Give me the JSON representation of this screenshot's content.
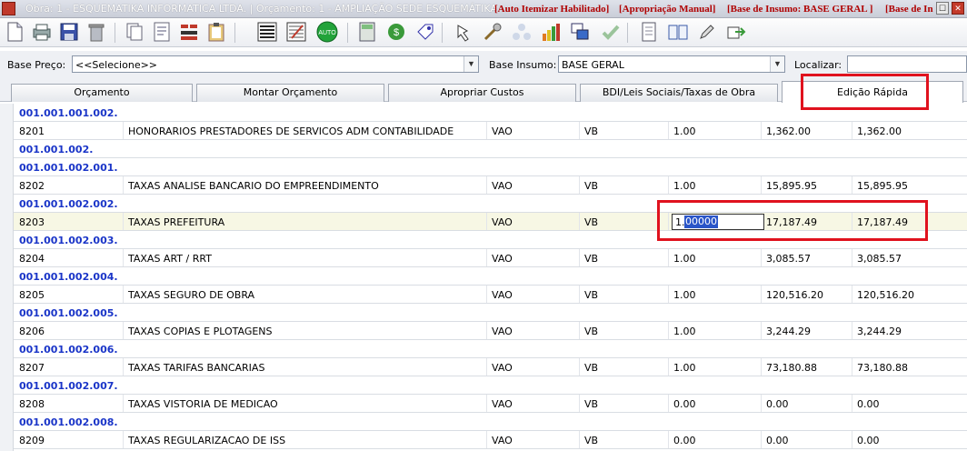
{
  "window": {
    "title": "Obra: 1 - ESQUEMATIKA INFORMATICA LTDA. | Orçamento: 1 - AMPLIAÇÃO SEDE ESQUEMÁTIKA",
    "flags": [
      "[Auto Itemizar Habilitado]",
      "[Apropriação Manual]",
      "[Base de Insumo: BASE GERAL ]",
      "[Base de In"
    ]
  },
  "toolbar": {
    "icons": [
      "new-document-icon",
      "print-icon",
      "save-icon",
      "trash-icon",
      "copy-icon",
      "report-icon",
      "chart-list-icon",
      "clipboard-icon",
      "list-view-icon",
      "edit-list-icon",
      "auto-icon",
      "calculator-icon",
      "money-icon",
      "tag-icon",
      "hand-icon",
      "tools-icon",
      "network-icon",
      "bar-chart-icon",
      "windows-icon",
      "check-icon",
      "document-icon",
      "book-icon",
      "pen-icon",
      "export-icon"
    ],
    "auto_label": "AUTO"
  },
  "filters": {
    "base_preco_label": "Base Preço:",
    "base_preco_value": "<<Selecione>>",
    "base_insumo_label": "Base Insumo:",
    "base_insumo_value": "BASE GERAL",
    "localizar_label": "Localizar:",
    "localizar_value": ""
  },
  "tabs": [
    "Orçamento",
    "Montar Orçamento",
    "Apropriar Custos",
    "BDI/Leis Sociais/Taxas de Obra",
    "Edição Rápida"
  ],
  "active_tab": "Edição Rápida",
  "rows": [
    {
      "type": "group",
      "code": "001.001.001.002."
    },
    {
      "type": "item",
      "code": "8201",
      "desc": "HONORARIOS PRESTADORES DE SERVICOS ADM CONTABILIDADE",
      "tipo": "VAO",
      "un": "VB",
      "qtd": "1.00",
      "preco": "1,362.00",
      "total": "1,362.00"
    },
    {
      "type": "group",
      "code": "001.001.002."
    },
    {
      "type": "group",
      "code": "001.001.002.001."
    },
    {
      "type": "item",
      "code": "8202",
      "desc": "TAXAS ANALISE BANCARIO DO EMPREENDIMENTO",
      "tipo": "VAO",
      "un": "VB",
      "qtd": "1.00",
      "preco": "15,895.95",
      "total": "15,895.95"
    },
    {
      "type": "group",
      "code": "001.001.002.002."
    },
    {
      "type": "item",
      "code": "8203",
      "desc": "TAXAS PREFEITURA",
      "tipo": "VAO",
      "un": "VB",
      "qtd": "",
      "preco": "17,187.49",
      "total": "17,187.49",
      "editing": true,
      "edit_prefix": "1.",
      "edit_selected": "00000"
    },
    {
      "type": "group",
      "code": "001.001.002.003."
    },
    {
      "type": "item",
      "code": "8204",
      "desc": "TAXAS ART / RRT",
      "tipo": "VAO",
      "un": "VB",
      "qtd": "1.00",
      "preco": "3,085.57",
      "total": "3,085.57"
    },
    {
      "type": "group",
      "code": "001.001.002.004."
    },
    {
      "type": "item",
      "code": "8205",
      "desc": "TAXAS SEGURO DE OBRA",
      "tipo": "VAO",
      "un": "VB",
      "qtd": "1.00",
      "preco": "120,516.20",
      "total": "120,516.20"
    },
    {
      "type": "group",
      "code": "001.001.002.005."
    },
    {
      "type": "item",
      "code": "8206",
      "desc": "TAXAS COPIAS E PLOTAGENS",
      "tipo": "VAO",
      "un": "VB",
      "qtd": "1.00",
      "preco": "3,244.29",
      "total": "3,244.29"
    },
    {
      "type": "group",
      "code": "001.001.002.006."
    },
    {
      "type": "item",
      "code": "8207",
      "desc": "TAXAS TARIFAS BANCARIAS",
      "tipo": "VAO",
      "un": "VB",
      "qtd": "1.00",
      "preco": "73,180.88",
      "total": "73,180.88"
    },
    {
      "type": "group",
      "code": "001.001.002.007."
    },
    {
      "type": "item",
      "code": "8208",
      "desc": "TAXAS VISTORIA DE MEDICAO",
      "tipo": "VAO",
      "un": "VB",
      "qtd": "0.00",
      "preco": "0.00",
      "total": "0.00"
    },
    {
      "type": "group",
      "code": "001.001.002.008."
    },
    {
      "type": "item",
      "code": "8209",
      "desc": "TAXAS REGULARIZACAO DE ISS",
      "tipo": "VAO",
      "un": "VB",
      "qtd": "0.00",
      "preco": "0.00",
      "total": "0.00"
    }
  ],
  "colors": {
    "group_text": "#1a35c8",
    "highlight_box": "#e0121e",
    "selected_row": "#f7f7e4"
  }
}
